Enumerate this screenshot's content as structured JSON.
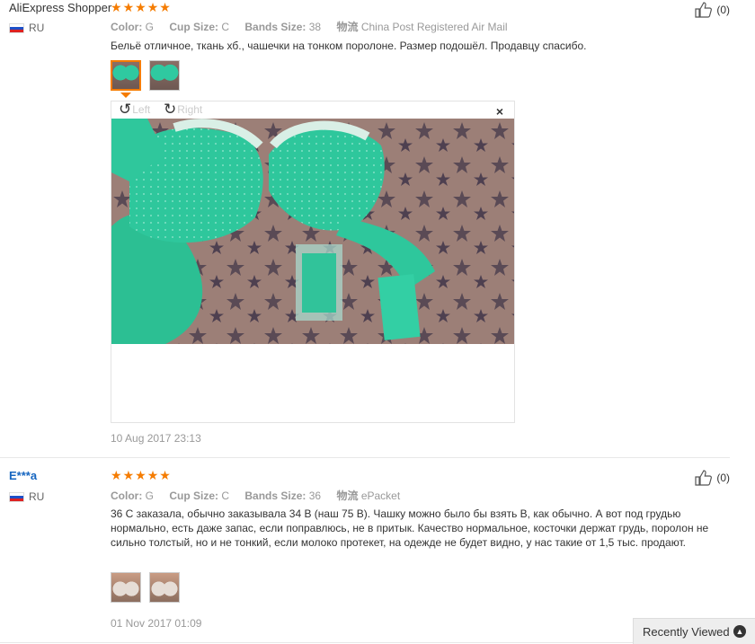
{
  "reviews": [
    {
      "user": "AliExpress Shopper",
      "country": "RU",
      "likes": "(0)",
      "color_label": "Color:",
      "color": "G",
      "cup_label": "Cup Size:",
      "cup": "C",
      "band_label": "Bands Size:",
      "band": "38",
      "ship_label": "物流",
      "ship": "China Post Registered Air Mail",
      "text": "Бельё отличное, ткань хб., чашечки на тонком поролоне. Размер подошёл. Продавцу спасибо.",
      "date": "10 Aug 2017 23:13",
      "viewer": {
        "left": "Left",
        "right": "Right",
        "close": "×"
      }
    },
    {
      "user": "E***a",
      "country": "RU",
      "likes": "(0)",
      "color_label": "Color:",
      "color": "G",
      "cup_label": "Cup Size:",
      "cup": "C",
      "band_label": "Bands Size:",
      "band": "36",
      "ship_label": "物流",
      "ship": "ePacket",
      "text": "36 С заказала, обычно заказывала 34 В (наш 75 В). Чашку можно было бы взять В, как обычно. А вот под грудью нормально, есть даже запас, если поправлюсь, не в притык. Качество нормальное, косточки держат грудь, поролон не сильно толстый, но и не тонкий, если молоко протекет, на одежде не будет видно, у нас такие от 1,5 тыс. продают.",
      "date": "01 Nov 2017 01:09"
    }
  ],
  "rating_stars": 5,
  "recently_viewed": "Recently Viewed",
  "colors": {
    "star": "#f57c00",
    "link": "#1565c0",
    "garment": "#2fc9a0"
  }
}
